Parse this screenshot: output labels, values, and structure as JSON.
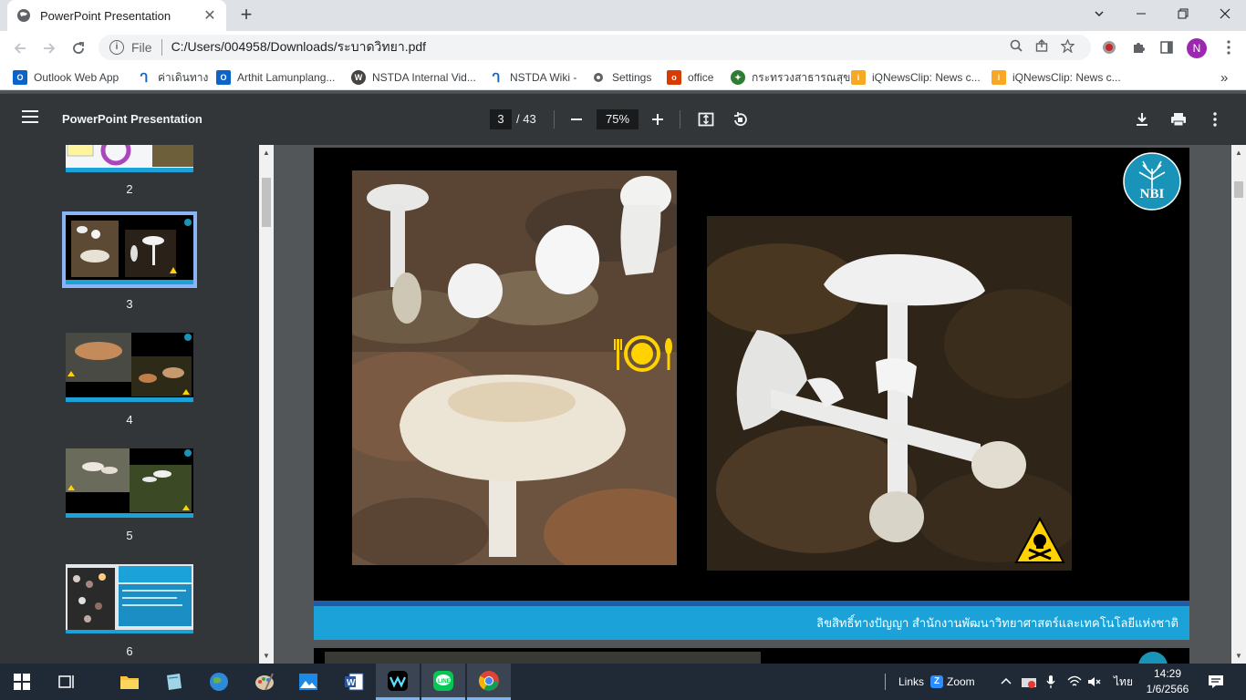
{
  "browser": {
    "tab_title": "PowerPoint Presentation",
    "tab_close": "✕",
    "new_tab": "+",
    "url_scheme": "File",
    "url": "C:/Users/004958/Downloads/ระบาดวิทยา.pdf",
    "profile_initial": "N"
  },
  "bookmarks": [
    {
      "label": "Outlook Web App",
      "icon": "outlook-icon"
    },
    {
      "label": "ค่าเดินทาง",
      "icon": "nstda-icon"
    },
    {
      "label": "Arthit Lamunplang...",
      "icon": "outlook-icon"
    },
    {
      "label": "NSTDA Internal Vid...",
      "icon": "wordpress-icon"
    },
    {
      "label": "NSTDA Wiki -",
      "icon": "nstda-icon"
    },
    {
      "label": "Settings",
      "icon": "gear-icon"
    },
    {
      "label": "office",
      "icon": "office-icon"
    },
    {
      "label": "กระทรวงสาธารณสุข",
      "icon": "moph-icon"
    },
    {
      "label": "iQNewsClip: News c...",
      "icon": "iqnews-icon"
    },
    {
      "label": "iQNewsClip: News c...",
      "icon": "iqnews-icon"
    }
  ],
  "bookmarks_more": "»",
  "pdf": {
    "title": "PowerPoint Presentation",
    "current_page": "3",
    "total_pages": "/ 43",
    "zoom": "75%"
  },
  "thumbnails": [
    {
      "number": "2"
    },
    {
      "number": "3"
    },
    {
      "number": "4"
    },
    {
      "number": "5"
    },
    {
      "number": "6"
    }
  ],
  "slide": {
    "logo_text": "NBI",
    "footer_text": "ลิขสิทธิ์ทางปัญญา สำนักงานพัฒนาวิทยาศาสตร์และเทคโนโลยีแห่งชาติ"
  },
  "taskbar": {
    "links_label": "Links",
    "zoom_label": "Zoom",
    "language": "ไทย",
    "time": "14:29",
    "date": "1/6/2566"
  },
  "colors": {
    "footer_blue": "#1ba2d8",
    "footer_line": "#1a5fa8",
    "selected_thumb": "#8ab4f8",
    "logo_teal": "#1a93b8",
    "edible_icon": "#ffd200",
    "poison_icon": "#ffd200"
  }
}
